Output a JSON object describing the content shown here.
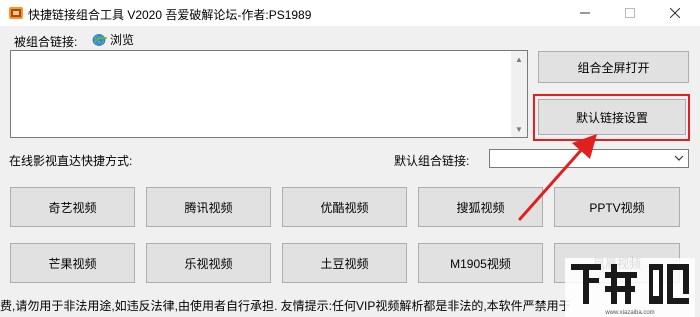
{
  "window": {
    "title": "快捷链接组合工具 V2020  吾爱破解论坛-作者:PS1989",
    "icon": "app-icon"
  },
  "links": {
    "label": "被组合链接:",
    "browse_label": "浏览",
    "textarea_value": ""
  },
  "actions": {
    "combine_fullscreen": "组合全屏打开",
    "default_link_settings": "默认链接设置"
  },
  "quick_access": {
    "label": "在线影视直达快捷方式:",
    "default_combo_label": "默认组合链接:",
    "default_combo_value": ""
  },
  "video_buttons": {
    "row1": [
      "奇艺视频",
      "腾讯视频",
      "优酷视频",
      "搜狐视频",
      "PPTV视频"
    ],
    "row2": [
      "芒果视频",
      "乐视视频",
      "土豆视频",
      "M1905视频",
      "凤凰视频"
    ]
  },
  "footer": {
    "text": "费,请勿用于非法用途,如违反法律,由使用者自行承担. 友情提示:任何VIP视频解析都是非法的,本软件严禁用于"
  },
  "watermark": {
    "text": "下载吧",
    "site": "www.xiazaiba.com"
  },
  "colors": {
    "highlight": "#e02020",
    "background": "#f0f0f0",
    "button": "#e1e1e1"
  }
}
